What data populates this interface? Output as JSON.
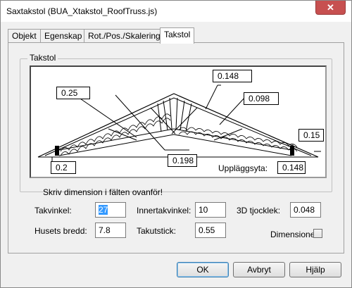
{
  "window": {
    "title": "Saxtakstol (BUA_Xtakstol_RoofTruss.js)",
    "close_glyph": "✕"
  },
  "tabs": [
    {
      "label": "Objekt"
    },
    {
      "label": "Egenskap"
    },
    {
      "label": "Rot./Pos./Skalering"
    },
    {
      "label": "Takstol",
      "active": true
    }
  ],
  "group": {
    "label": "Takstol"
  },
  "diagram": {
    "dims": {
      "top_left": "0.25",
      "top_right": "0.148",
      "mid_right": "0.098",
      "right_end": "0.15",
      "bottom_left": "0.2",
      "bottom_center": "0.198",
      "bearing": "0.148"
    },
    "bearing_label": "Uppläggsyta:"
  },
  "instruction": "Skriv dimension i fälten ovanför!",
  "fields": {
    "takvinkel": {
      "label": "Takvinkel:",
      "value": "27"
    },
    "husets_bredd": {
      "label": "Husets bredd:",
      "value": "7.8"
    },
    "innertakvinkel": {
      "label": "Innertakvinkel:",
      "value": "10"
    },
    "takutstick": {
      "label": "Takutstick:",
      "value": "0.55"
    },
    "tjocklek": {
      "label": "3D tjocklek:",
      "value": "0.048"
    },
    "dimensioner": {
      "label": "Dimensioner",
      "checked": false
    }
  },
  "buttons": {
    "ok": "OK",
    "cancel": "Avbryt",
    "help": "Hjälp"
  }
}
